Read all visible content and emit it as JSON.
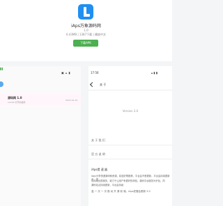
{
  "app": {
    "name": "iAps万象源码网",
    "version": "1.0",
    "meta": "6.43MB | 1387下载 | 播放中文",
    "download_label": "下载APK"
  },
  "phone_left": {
    "status_icons": "▣ ▴ ▮",
    "card": {
      "title": "源码网 1.0",
      "subtitle": "vcolist 打开的插件",
      "time": "2023-01-01"
    }
  },
  "phone_right": {
    "status_time": "17:56",
    "status_icons": "▴ ▮ ▮",
    "nav_title": "关 于",
    "version_text": "Version 3.0",
    "row_1": "关 于 我 们",
    "row_2": "官 方 说 明",
    "section_title": "iAps提 速 器",
    "body_text_1": "iAps分享快递源码和资源，精选好物推荐，平台会不断更新，平台会持续更新中，提",
    "body_text_2": "供持续优质服务，致力于让用户有更好的体验，源码平台服务为宗旨，同",
    "body_text_3": "源码站点持续更新，平台会持续",
    "footer_text": "温 一 次 一 次 推 动 开 源 前 端，iAps发展会更新 3.0"
  },
  "colors": {
    "brand_blue": "#1f8ff2",
    "download_green": "#4caf50"
  }
}
